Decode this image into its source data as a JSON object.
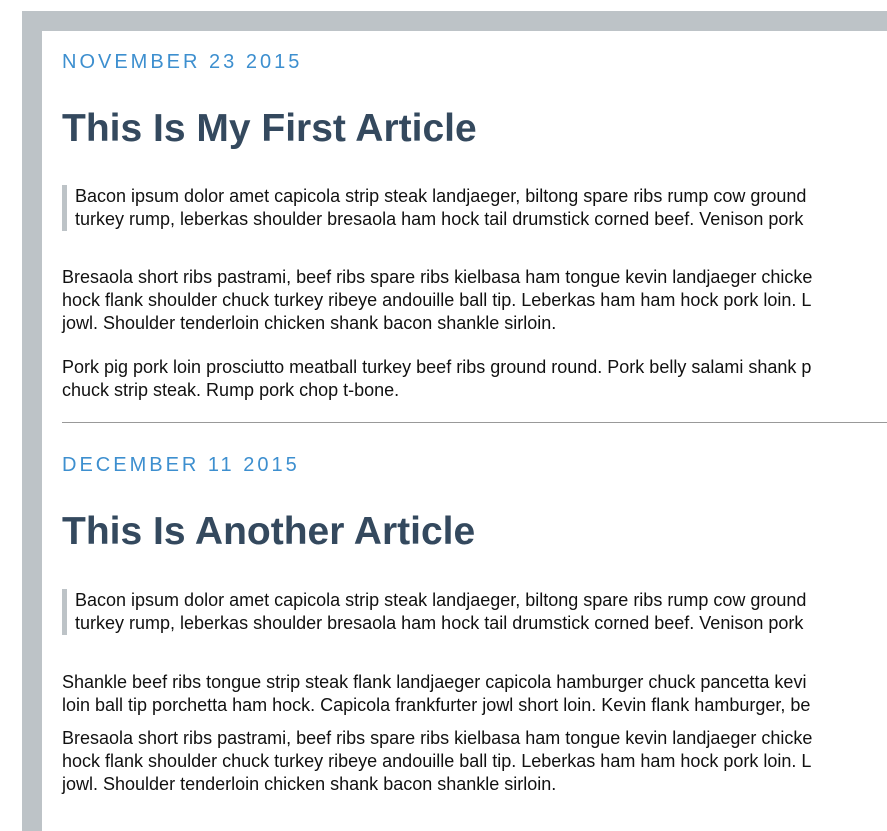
{
  "articles": [
    {
      "date": "NOVEMBER 23 2015",
      "title": "This Is My First Article",
      "quote_lines": [
        "Bacon ipsum dolor amet capicola strip steak landjaeger, biltong spare ribs rump cow ground",
        "turkey rump, leberkas shoulder bresaola ham hock tail drumstick corned beef. Venison pork"
      ],
      "paragraphs": [
        [
          "Bresaola short ribs pastrami, beef ribs spare ribs kielbasa ham tongue kevin landjaeger chicke",
          "hock flank shoulder chuck turkey ribeye andouille ball tip. Leberkas ham ham hock pork loin. L",
          "jowl. Shoulder tenderloin chicken shank bacon shankle sirloin."
        ],
        [
          "Pork pig pork loin prosciutto meatball turkey beef ribs ground round. Pork belly salami shank p",
          "chuck strip steak. Rump pork chop t-bone."
        ]
      ]
    },
    {
      "date": "DECEMBER 11 2015",
      "title": "This Is Another Article",
      "quote_lines": [
        "Bacon ipsum dolor amet capicola strip steak landjaeger, biltong spare ribs rump cow ground",
        "turkey rump, leberkas shoulder bresaola ham hock tail drumstick corned beef. Venison pork"
      ],
      "paragraphs": [
        [
          "Shankle beef ribs tongue strip steak flank landjaeger capicola hamburger chuck pancetta kevi",
          "loin ball tip porchetta ham hock. Capicola frankfurter jowl short loin. Kevin flank hamburger, be"
        ],
        [
          "Bresaola short ribs pastrami, beef ribs spare ribs kielbasa ham tongue kevin landjaeger chicke",
          "hock flank shoulder chuck turkey ribeye andouille ball tip. Leberkas ham ham hock pork loin. L",
          "jowl. Shoulder tenderloin chicken shank bacon shankle sirloin."
        ]
      ]
    }
  ]
}
